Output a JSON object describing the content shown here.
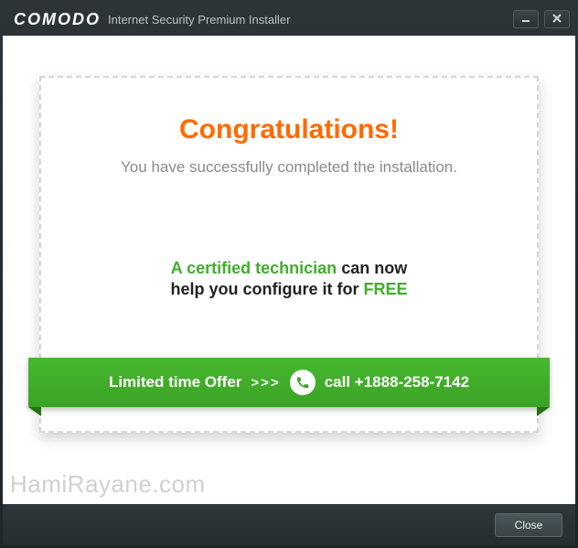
{
  "titlebar": {
    "brand": "COMODO",
    "subtitle": "Internet Security Premium Installer"
  },
  "content": {
    "heading": "Congratulations!",
    "subheading": "You have successfully completed the installation.",
    "tech_prefix": "A certified technician",
    "tech_suffix": " can now",
    "help_prefix": "help you configure it for ",
    "help_free": "FREE"
  },
  "ribbon": {
    "offer": "Limited time Offer",
    "chevrons": ">>>",
    "call_label": "call ",
    "phone": "+1888-258-7142"
  },
  "footer": {
    "close": "Close"
  },
  "watermark": "HamiRayane.com"
}
